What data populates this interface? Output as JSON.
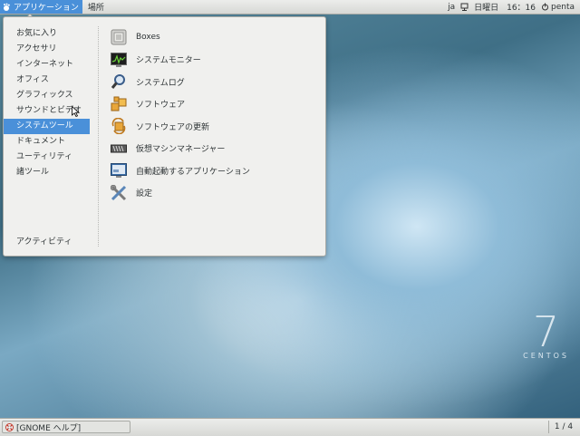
{
  "topbar": {
    "applications_label": "アプリケーション",
    "places_label": "場所",
    "input_method": "ja",
    "clock": "日曜日　16：16",
    "user": "penta"
  },
  "menu": {
    "categories": [
      {
        "label": "お気に入り"
      },
      {
        "label": "アクセサリ"
      },
      {
        "label": "インターネット"
      },
      {
        "label": "オフィス"
      },
      {
        "label": "グラフィックス"
      },
      {
        "label": "サウンドとビデオ"
      },
      {
        "label": "システムツール",
        "selected": true
      },
      {
        "label": "ドキュメント"
      },
      {
        "label": "ユーティリティ"
      },
      {
        "label": "諸ツール"
      }
    ],
    "activities_label": "アクティビティ",
    "apps": [
      {
        "label": "Boxes",
        "icon": "boxes-icon"
      },
      {
        "label": "システムモニター",
        "icon": "system-monitor-icon"
      },
      {
        "label": "システムログ",
        "icon": "system-log-icon"
      },
      {
        "label": "ソフトウェア",
        "icon": "software-icon"
      },
      {
        "label": "ソフトウェアの更新",
        "icon": "software-update-icon"
      },
      {
        "label": "仮想マシンマネージャー",
        "icon": "virt-manager-icon"
      },
      {
        "label": "自動起動するアプリケーション",
        "icon": "startup-apps-icon"
      },
      {
        "label": "設定",
        "icon": "settings-icon"
      }
    ]
  },
  "desktop": {
    "logo_number": "7",
    "logo_name": "CENTOS"
  },
  "bottombar": {
    "task_label": "[GNOME ヘルプ]",
    "workspace": "1 / 4"
  },
  "colors": {
    "accent": "#4a90d9",
    "panel": "#e3e4e1"
  }
}
